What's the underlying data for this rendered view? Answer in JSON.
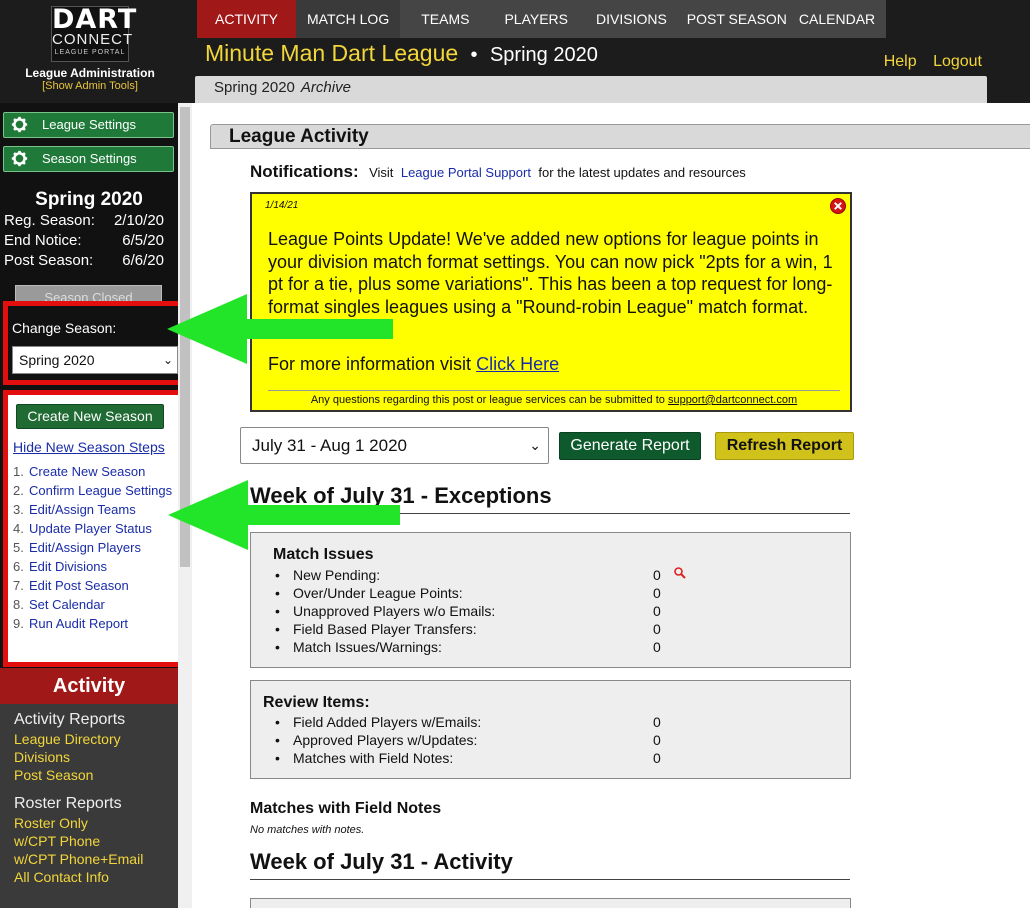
{
  "logo": {
    "line1": "DART",
    "line2": "CONNECT",
    "line3": "LEAGUE PORTAL"
  },
  "admin": {
    "title": "League Administration",
    "show_tools": "[Show Admin Tools]"
  },
  "nav": {
    "tabs": [
      {
        "label": "ACTIVITY"
      },
      {
        "label": "MATCH LOG"
      },
      {
        "label": "TEAMS"
      },
      {
        "label": "PLAYERS"
      },
      {
        "label": "DIVISIONS"
      },
      {
        "label": "POST SEASON"
      },
      {
        "label": "CALENDAR"
      }
    ],
    "help": "Help",
    "logout": "Logout"
  },
  "header": {
    "league_name": "Minute Man Dart League",
    "separator": "•",
    "season": "Spring 2020",
    "breadcrumb_season": "Spring 2020",
    "breadcrumb_archive": "Archive"
  },
  "sidebar": {
    "league_settings": "League Settings",
    "season_settings": "Season Settings",
    "season_name": "Spring 2020",
    "dates": [
      {
        "label": "Reg. Season:",
        "value": "2/10/20"
      },
      {
        "label": "End Notice:",
        "value": "6/5/20"
      },
      {
        "label": "Post Season:",
        "value": "6/6/20"
      }
    ],
    "season_closed": "Season Closed",
    "change_season_label": "Change Season:",
    "change_season_value": "Spring 2020",
    "create_new_season": "Create New Season",
    "hide_steps": "Hide New Season Steps",
    "steps": [
      {
        "num": "1.",
        "label": "Create New Season"
      },
      {
        "num": "2.",
        "label": "Confirm League Settings"
      },
      {
        "num": "3.",
        "label": "Edit/Assign Teams"
      },
      {
        "num": "4.",
        "label": "Update Player Status"
      },
      {
        "num": "5.",
        "label": "Edit/Assign Players"
      },
      {
        "num": "6.",
        "label": "Edit Divisions"
      },
      {
        "num": "7.",
        "label": "Edit Post Season"
      },
      {
        "num": "8.",
        "label": "Set Calendar"
      },
      {
        "num": "9.",
        "label": "Run Audit Report"
      }
    ],
    "activity_title": "Activity",
    "activity_reports_title": "Activity Reports",
    "activity_reports": [
      "League Directory",
      "Divisions",
      "Post Season"
    ],
    "roster_reports_title": "Roster Reports",
    "roster_reports": [
      "Roster Only",
      "w/CPT Phone",
      "w/CPT Phone+Email",
      "All Contact Info"
    ]
  },
  "main": {
    "section_title": "League Activity",
    "notifications_label": "Notifications:",
    "notifications_pre": "Visit",
    "notifications_link": "League Portal Support",
    "notifications_post": "for the latest updates and resources",
    "notice": {
      "date": "1/14/21",
      "body": "League Points Update! We've added new options for league points in your division match format settings. You can now pick \"2pts for a win, 1 pt for a tie, plus some variations\". This has been a top request for long-format singles leagues using a \"Round-robin League\" match format.",
      "more_text": "For more information visit",
      "more_link": "Click Here",
      "footer_text": "Any questions regarding this post or league services can be submitted to",
      "footer_email": "support@dartconnect.com"
    },
    "week_select": "July 31 - Aug 1 2020",
    "generate_report": "Generate Report",
    "refresh_report": "Refresh Report",
    "exceptions_title": "Week of July 31 - Exceptions",
    "match_issues": {
      "title": "Match Issues",
      "items": [
        {
          "label": "New Pending:",
          "value": "0"
        },
        {
          "label": "Over/Under League Points:",
          "value": "0"
        },
        {
          "label": "Unapproved Players w/o Emails:",
          "value": "0"
        },
        {
          "label": "Field Based Player Transfers:",
          "value": "0"
        },
        {
          "label": "Match Issues/Warnings:",
          "value": "0"
        }
      ]
    },
    "review_items": {
      "title": "Review Items:",
      "items": [
        {
          "label": "Field Added Players w/Emails:",
          "value": "0"
        },
        {
          "label": "Approved Players w/Updates:",
          "value": "0"
        },
        {
          "label": "Matches with Field Notes:",
          "value": "0"
        }
      ]
    },
    "field_notes_title": "Matches with Field Notes",
    "field_notes_empty": "No matches with notes.",
    "activity_title": "Week of July 31 - Activity"
  },
  "colors": {
    "nav_active": "#a01818",
    "accent_yellow": "#f2d63a",
    "notice_bg": "#ffff00",
    "highlight_red": "#e30f0f",
    "arrow_green": "#22e52a"
  }
}
